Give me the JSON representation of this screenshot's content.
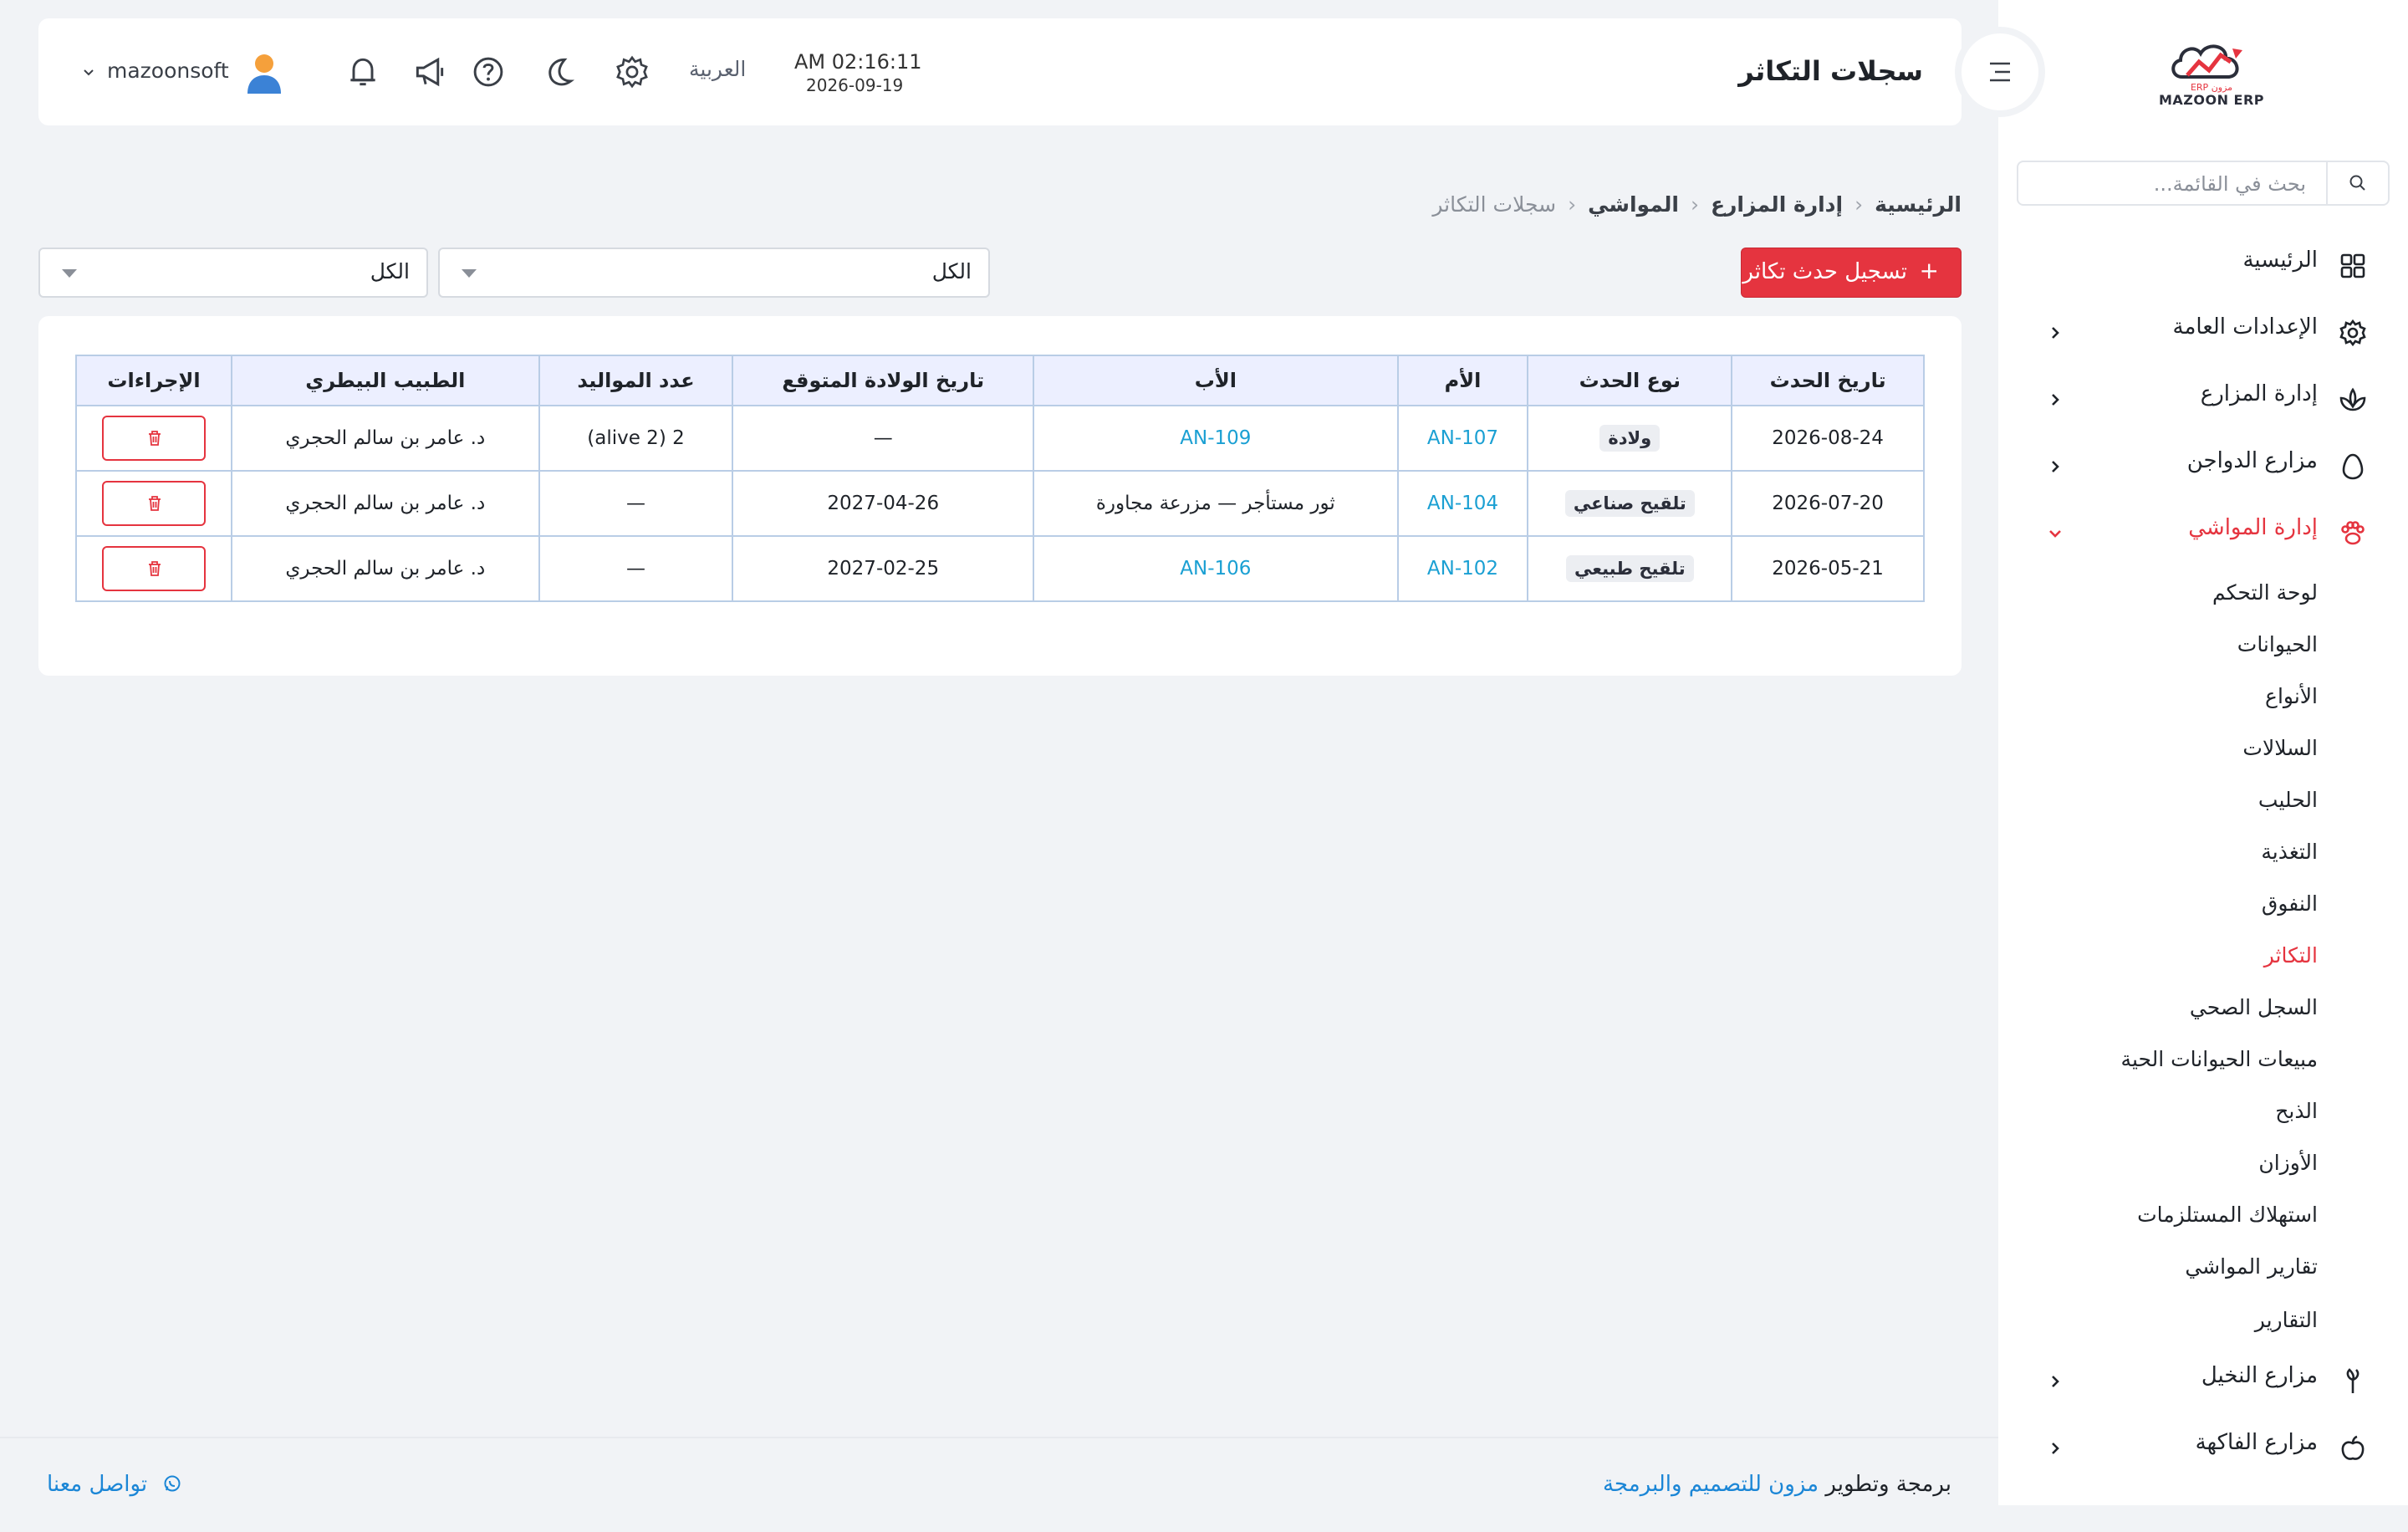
{
  "header": {
    "title": "سجلات التكاثر",
    "time": "AM 02:16:11",
    "date": "2026-09-19",
    "language": "العربية",
    "username": "mazoonsoft"
  },
  "sidebar": {
    "logo_text": "MAZOON ERP",
    "logo_small": "ERP مزون",
    "search_placeholder": "بحث في القائمة...",
    "items": [
      {
        "label": "الرئيسية",
        "icon": "dashboard-grid-icon"
      },
      {
        "label": "الإعدادات العامة",
        "icon": "gear-icon"
      },
      {
        "label": "إدارة المزارع",
        "icon": "plant-icon"
      },
      {
        "label": "مزارع الدواجن",
        "icon": "egg-icon"
      },
      {
        "label": "إدارة المواشي",
        "icon": "paw-icon"
      },
      {
        "label": "مزارع النخيل",
        "icon": "palm-tree-icon"
      },
      {
        "label": "مزارع الفاكهة",
        "icon": "apple-icon"
      }
    ],
    "livestock_sub": [
      "لوحة التحكم",
      "الحيوانات",
      "الأنواع",
      "السلالات",
      "الحليب",
      "التغذية",
      "النفوق",
      "التكاثر",
      "السجل الصحي",
      "مبيعات الحيوانات الحية",
      "الذبح",
      "الأوزان",
      "استهلاك المستلزمات",
      "تقارير المواشي",
      "التقارير"
    ]
  },
  "breadcrumb": {
    "home": "الرئيسية",
    "farms": "إدارة المزارع",
    "livestock": "المواشي",
    "current": "سجلات التكاثر"
  },
  "toolbar": {
    "add_label": "تسجيل حدث تكاثر",
    "filter1_value": "الكل",
    "filter2_value": "الكل"
  },
  "table": {
    "headers": [
      "تاريخ الحدث",
      "نوع الحدث",
      "الأم",
      "الأب",
      "تاريخ الولادة المتوقع",
      "عدد المواليد",
      "الطبيب البيطري",
      "الإجراءات"
    ],
    "rows": [
      {
        "date": "2026-08-24",
        "type": "ولادة",
        "mother": "AN-107",
        "father": "AN-109",
        "expected": "—",
        "births": "2 (alive 2)",
        "vet": "د. عامر بن سالم الحجري"
      },
      {
        "date": "2026-07-20",
        "type": "تلقيح صناعي",
        "mother": "AN-104",
        "father": "ثور مستأجر — مزرعة مجاورة",
        "expected": "2027-04-26",
        "births": "—",
        "vet": "د. عامر بن سالم الحجري"
      },
      {
        "date": "2026-05-21",
        "type": "تلقيح طبيعي",
        "mother": "AN-102",
        "father": "AN-106",
        "expected": "2027-02-25",
        "births": "—",
        "vet": "د. عامر بن سالم الحجري"
      }
    ]
  },
  "footer": {
    "credit_prefix": "برمجة وتطوير",
    "credit_brand": "مزون للتصميم والبرمجة",
    "contact": "تواصل معنا"
  },
  "colors": {
    "accent": "#e5343f",
    "link": "#1ba0d3",
    "brand_link": "#1b86d6",
    "background": "#f1f3f6"
  }
}
